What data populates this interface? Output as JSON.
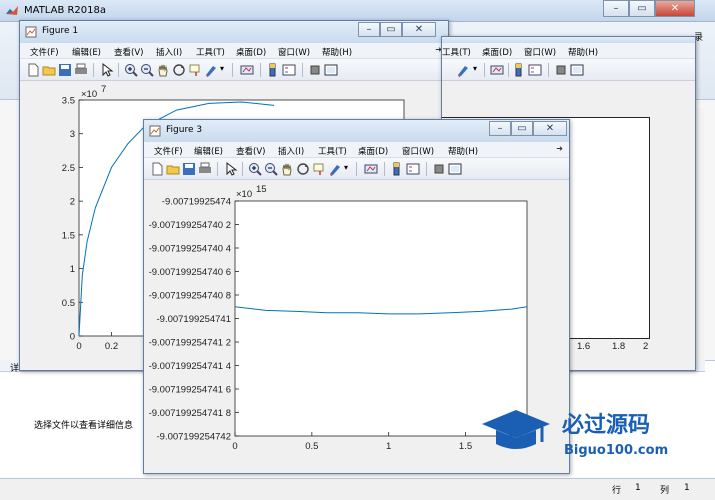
{
  "app": {
    "title": "MATLAB R2018a"
  },
  "main": {
    "detail_label": "详",
    "detail_message": "选择文件以查看详细信息",
    "status": {
      "row_label": "行",
      "row_value": "1",
      "col_label": "列",
      "col_value": "1"
    },
    "side_text": "录"
  },
  "menus": {
    "file": "文件(F)",
    "edit": "编辑(E)",
    "view": "查看(V)",
    "insert": "插入(I)",
    "tools": "工具(T)",
    "desktop": "桌面(D)",
    "window": "窗口(W)",
    "help": "帮助(H)"
  },
  "figure1": {
    "title": "Figure 1",
    "exponent": "7",
    "y_ticks": [
      "3.5",
      "3",
      "2.5",
      "2",
      "1.5",
      "1",
      "0.5",
      "0"
    ],
    "x_ticks_left": [
      "0",
      "0.2"
    ],
    "x_ticks_right": [
      "1.6",
      "1.8",
      "2"
    ]
  },
  "figure3": {
    "title": "Figure 3",
    "exponent": "15",
    "y_ticks": [
      "-9.00719925474",
      "-9.007199254740 2",
      "-9.007199254740 4",
      "-9.007199254740 6",
      "-9.007199254740 8",
      "-9.007199254741",
      "-9.007199254741 2",
      "-9.007199254741 4",
      "-9.007199254741 6",
      "-9.007199254741 8",
      "-9.007199254742"
    ],
    "x_ticks": [
      "0",
      "0.5",
      "1",
      "1.5"
    ]
  },
  "watermark": {
    "line1": "必过源码",
    "line2": "Biguo100.com"
  },
  "colors": {
    "series": "#0072bd",
    "axes_bg": "#ffffff",
    "title_bar": "#c9dbee"
  },
  "chart_data": [
    {
      "type": "line",
      "title": "",
      "xlabel": "",
      "ylabel": "",
      "xlim": [
        0,
        2
      ],
      "ylim": [
        0,
        3.5
      ],
      "y_exponent": 7,
      "series": [
        {
          "x": [
            0,
            0.02,
            0.05,
            0.1,
            0.2,
            0.3,
            0.4,
            0.6,
            0.8,
            1.0,
            1.2
          ],
          "y": [
            0,
            0.9,
            1.4,
            1.9,
            2.5,
            2.85,
            3.1,
            3.35,
            3.45,
            3.47,
            3.42
          ]
        }
      ]
    },
    {
      "type": "line",
      "title": "",
      "xlabel": "",
      "ylabel": "",
      "xlim": [
        0,
        1.9
      ],
      "ylim": [
        -9.007199254742,
        -9.00719925474
      ],
      "y_exponent": 15,
      "series": [
        {
          "x": [
            0,
            0.2,
            0.4,
            0.6,
            0.8,
            1.0,
            1.2,
            1.4,
            1.6,
            1.8,
            1.9
          ],
          "y": [
            -9.0071992547409,
            -9.00719925474093,
            -9.00719925474094,
            -9.00719925474095,
            -9.00719925474095,
            -9.00719925474096,
            -9.00719925474096,
            -9.00719925474095,
            -9.00719925474094,
            -9.00719925474092,
            -9.0071992547409
          ]
        }
      ]
    }
  ]
}
